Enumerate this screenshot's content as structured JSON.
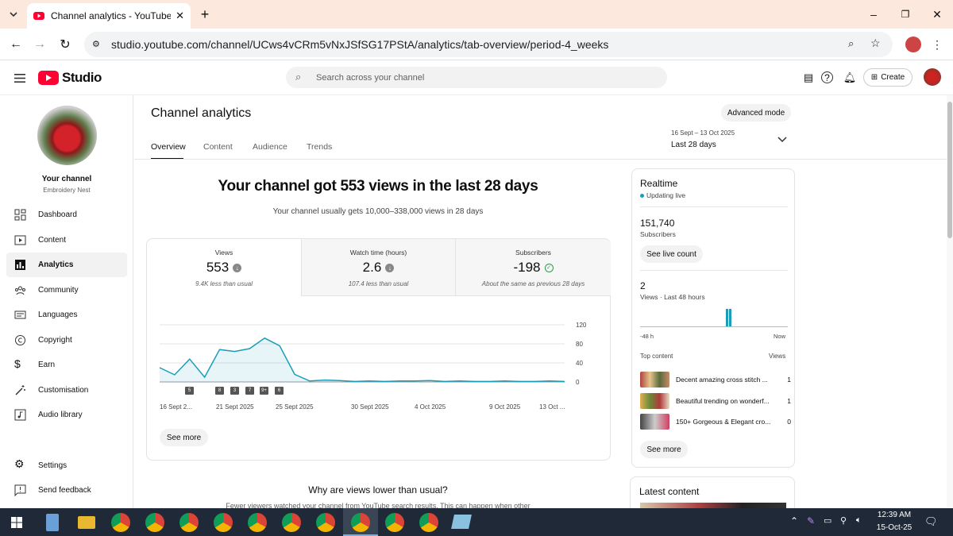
{
  "browser": {
    "tab_title": "Channel analytics - YouTube Studio",
    "url": "studio.youtube.com/channel/UCws4vCRm5vNxJSfSG17PStA/analytics/tab-overview/period-4_weeks"
  },
  "header": {
    "logo_text": "Studio",
    "search_placeholder": "Search across your channel",
    "create_label": "Create"
  },
  "sidebar": {
    "channel_label": "Your channel",
    "channel_name": "Embroidery Nest",
    "items": [
      {
        "label": "Dashboard"
      },
      {
        "label": "Content"
      },
      {
        "label": "Analytics"
      },
      {
        "label": "Community"
      },
      {
        "label": "Languages"
      },
      {
        "label": "Copyright"
      },
      {
        "label": "Earn"
      },
      {
        "label": "Customisation"
      },
      {
        "label": "Audio library"
      }
    ],
    "settings": "Settings",
    "feedback": "Send feedback"
  },
  "page": {
    "title": "Channel analytics",
    "advanced": "Advanced mode",
    "tabs": [
      "Overview",
      "Content",
      "Audience",
      "Trends"
    ],
    "date_range": "16 Sept – 13 Oct 2025",
    "period": "Last 28 days"
  },
  "summary": {
    "headline": "Your channel got 553 views in the last 28 days",
    "subline": "Your channel usually gets 10,000–338,000 views in 28 days"
  },
  "metrics": [
    {
      "label": "Views",
      "value": "553",
      "note": "9.4K less than usual"
    },
    {
      "label": "Watch time (hours)",
      "value": "2.6",
      "note": "107.4 less than usual"
    },
    {
      "label": "Subscribers",
      "value": "-198",
      "note": "About the same as previous 28 days"
    }
  ],
  "chart_data": {
    "type": "line",
    "x": [
      "16 Sept 2025",
      "17 Sept",
      "18 Sept",
      "19 Sept",
      "20 Sept",
      "21 Sept",
      "22 Sept",
      "23 Sept",
      "24 Sept",
      "25 Sept",
      "26 Sept",
      "27 Sept",
      "28 Sept",
      "29 Sept",
      "30 Sept",
      "1 Oct",
      "2 Oct",
      "3 Oct",
      "4 Oct",
      "5 Oct",
      "6 Oct",
      "7 Oct",
      "8 Oct",
      "9 Oct",
      "10 Oct",
      "11 Oct",
      "12 Oct",
      "13 Oct"
    ],
    "values": [
      30,
      15,
      48,
      10,
      68,
      64,
      70,
      92,
      76,
      16,
      2,
      4,
      3,
      1,
      2,
      1,
      2,
      2,
      3,
      1,
      2,
      1,
      1,
      2,
      1,
      1,
      2,
      1
    ],
    "xtick_labels": [
      "16 Sept 2...",
      "21 Sept 2025",
      "25 Sept 2025",
      "30 Sept 2025",
      "4 Oct 2025",
      "9 Oct 2025",
      "13 Oct ..."
    ],
    "yticks": [
      "120",
      "80",
      "40",
      "0"
    ],
    "ylim": [
      0,
      120
    ],
    "markers": [
      "5",
      "8",
      "3",
      "7",
      "9+",
      "6"
    ]
  },
  "see_more": "See more",
  "why": {
    "title": "Why are views lower than usual?",
    "text": "Fewer viewers watched your channel from YouTube search results. This can happen when other"
  },
  "realtime": {
    "title": "Realtime",
    "status": "Updating live",
    "subs": "151,740",
    "subs_label": "Subscribers",
    "live_btn": "See live count",
    "views": "2",
    "views_label": "Views · Last 48 hours",
    "left": "-48 h",
    "right": "Now",
    "top_label": "Top content",
    "views_col": "Views",
    "top": [
      {
        "title": "Decent amazing cross stitch ...",
        "views": "1"
      },
      {
        "title": "Beautiful trending on wonderf...",
        "views": "1"
      },
      {
        "title": "150+ Gorgeous & Elegant cro...",
        "views": "0"
      }
    ],
    "see_more": "See more"
  },
  "latest": {
    "title": "Latest content"
  },
  "taskbar": {
    "time": "12:39 AM",
    "date": "15-Oct-25"
  },
  "colors": {
    "accent": "#1a9eb8",
    "yt_red": "#ff0033"
  }
}
